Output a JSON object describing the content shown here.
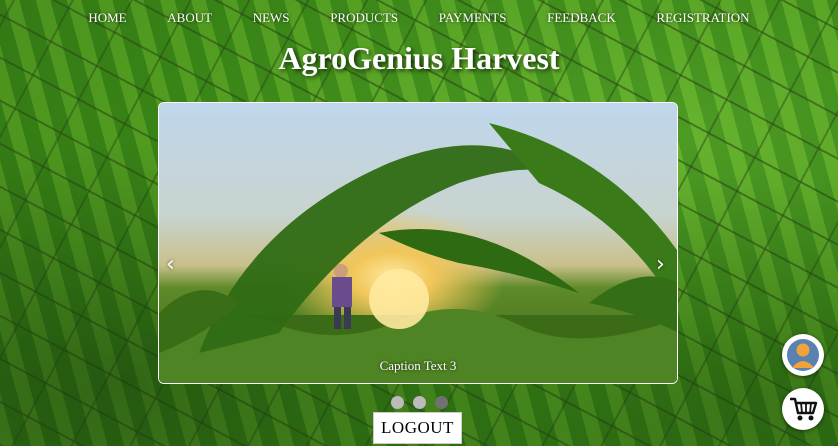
{
  "app": {
    "title": "AgroGenius Harvest"
  },
  "nav": {
    "items": [
      {
        "label": "HOME"
      },
      {
        "label": "ABOUT"
      },
      {
        "label": "NEWS"
      },
      {
        "label": "PRODUCTS"
      },
      {
        "label": "PAYMENTS"
      },
      {
        "label": "FEEDBACK"
      },
      {
        "label": "REGISTRATION"
      }
    ]
  },
  "slideshow": {
    "caption": "Caption Text 3",
    "prev_symbol": "‹",
    "next_symbol": "›",
    "active_index": 3,
    "dot_count": 3
  },
  "actions": {
    "logout_label": "LOGOUT"
  },
  "floating": {
    "profile_icon": "user-avatar-icon",
    "cart_icon": "shopping-cart-icon"
  },
  "colors": {
    "text_on_image": "#ffffff",
    "dot_inactive": "#bbbbbb",
    "dot_active": "#717171"
  }
}
